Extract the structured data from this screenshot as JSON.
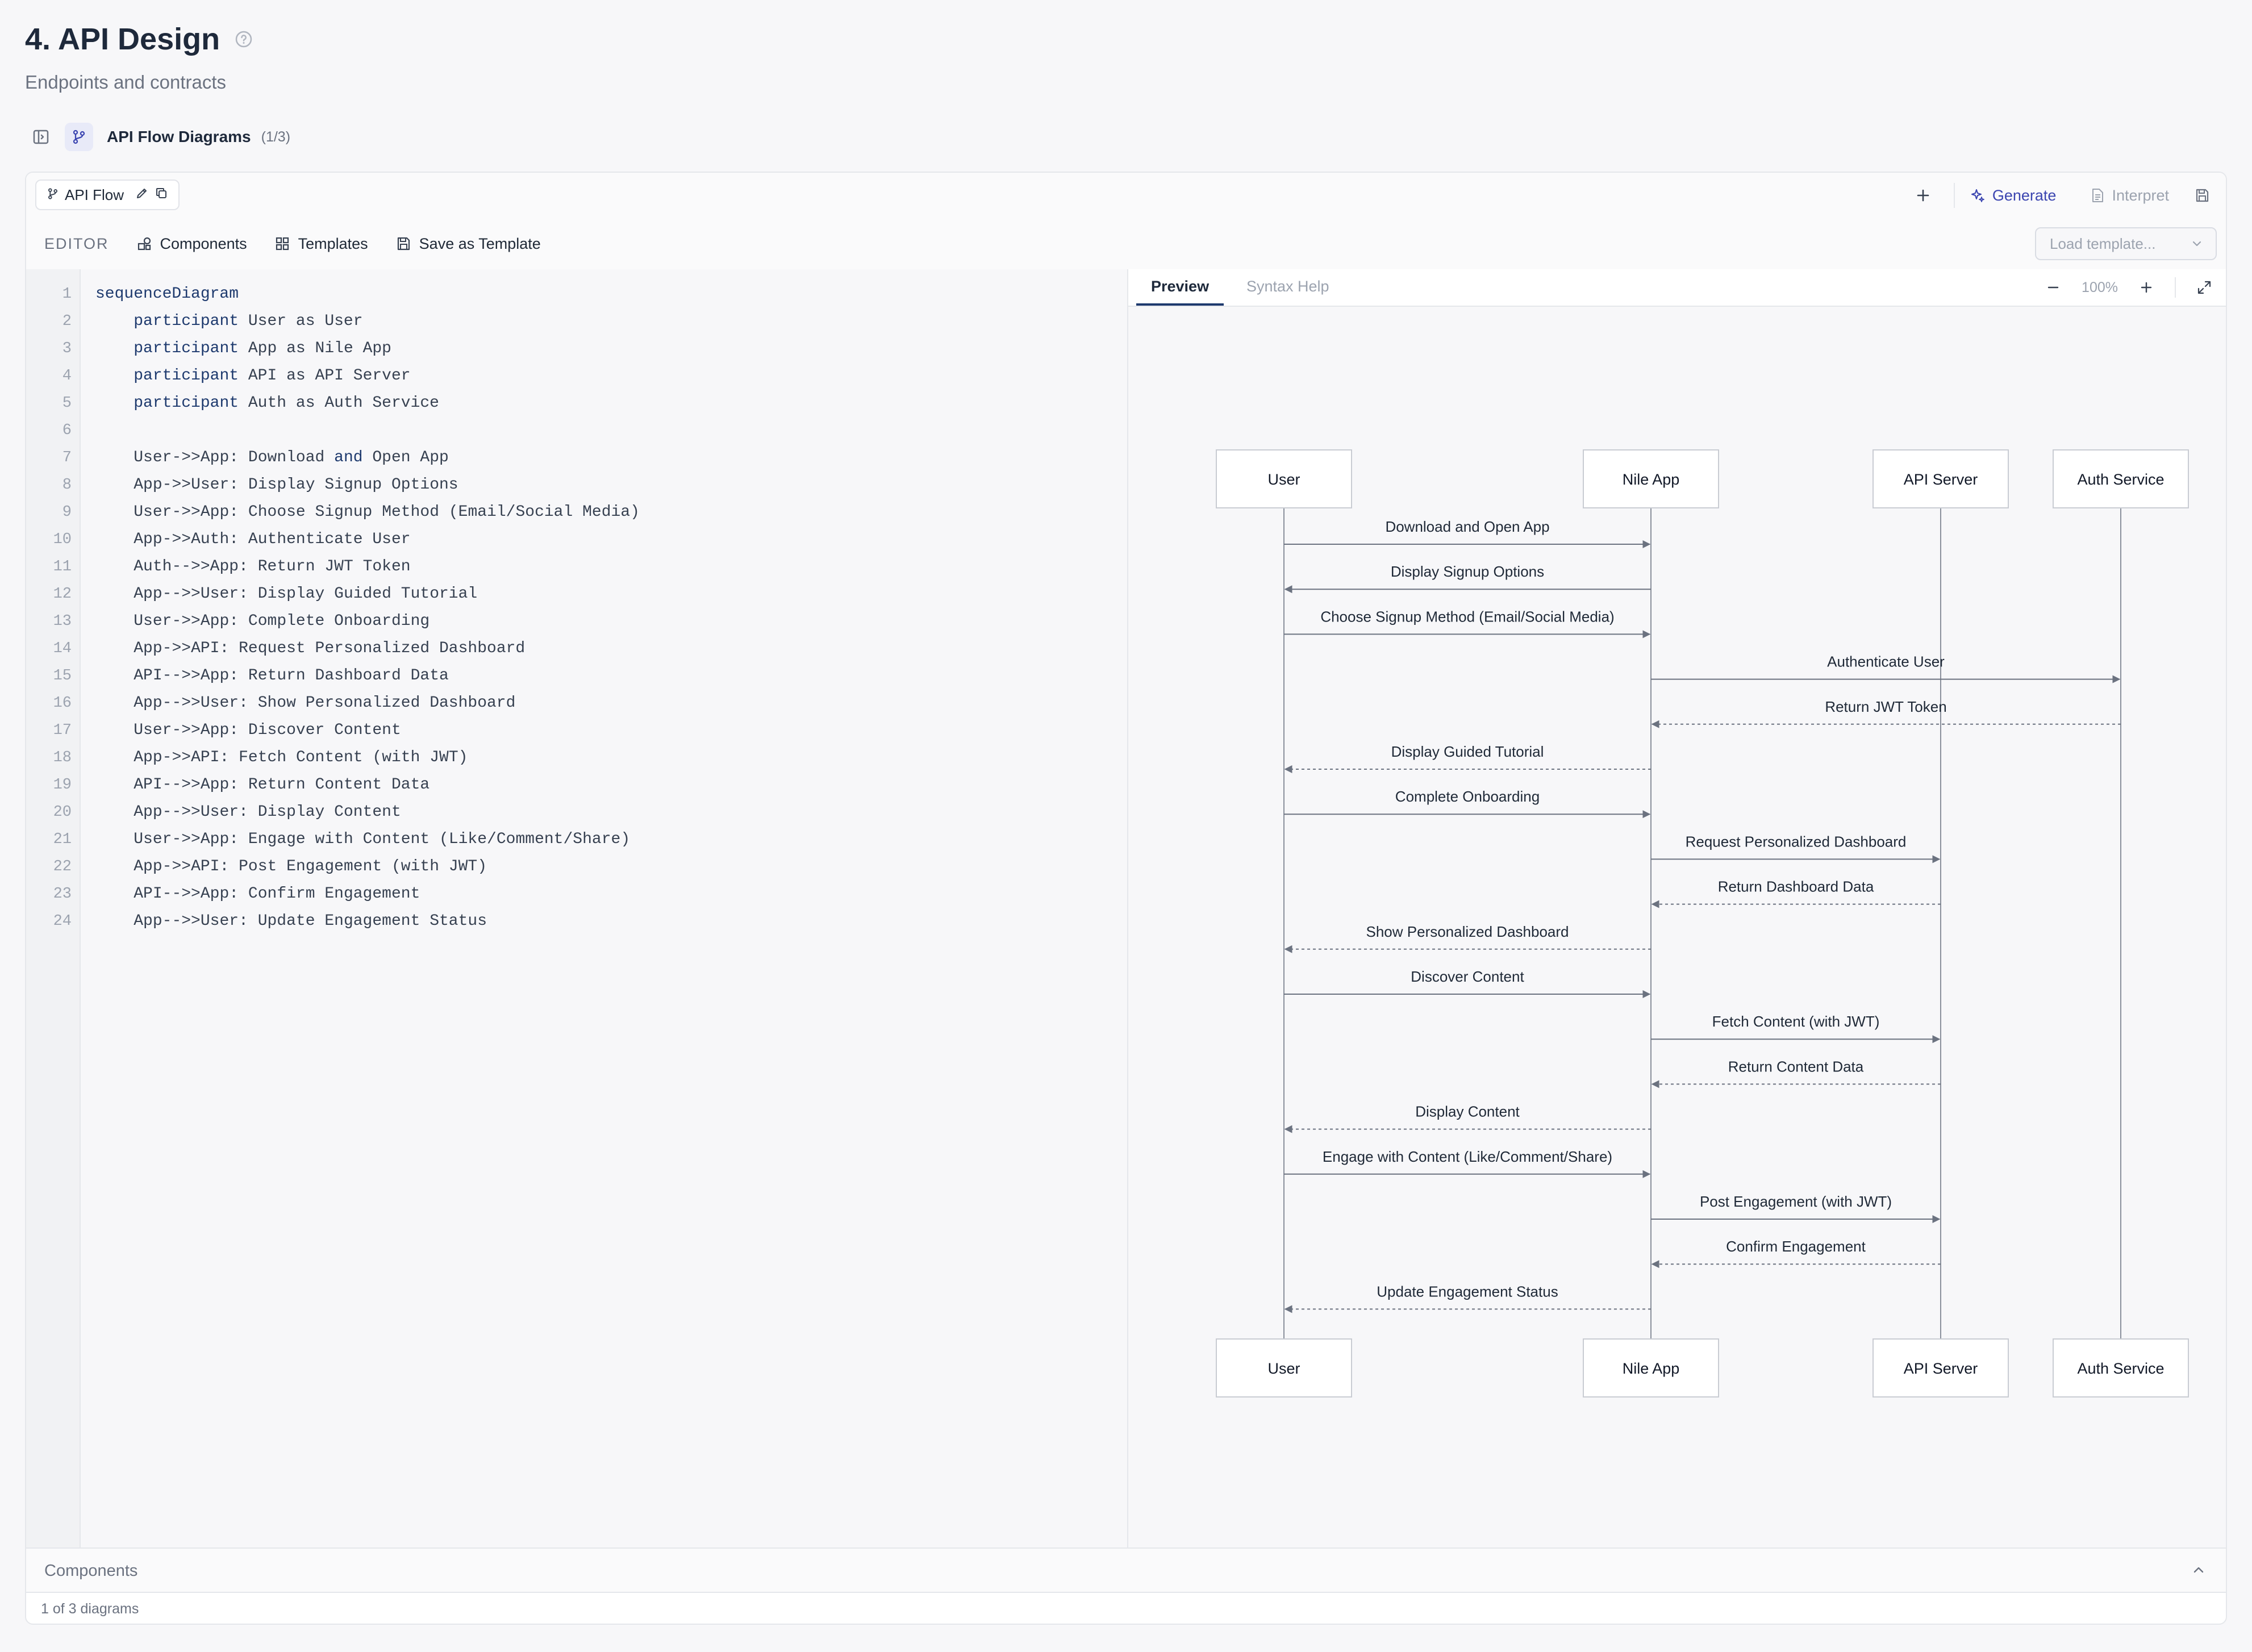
{
  "page": {
    "title": "4. API Design",
    "subtitle": "Endpoints and contracts"
  },
  "section": {
    "title": "API Flow Diagrams",
    "count": "(1/3)"
  },
  "diagram_tab": {
    "label": "API Flow"
  },
  "top_actions": {
    "generate": "Generate",
    "interpret": "Interpret"
  },
  "toolbar": {
    "editor_label": "EDITOR",
    "components": "Components",
    "templates": "Templates",
    "save_as_template": "Save as Template",
    "load_template_placeholder": "Load template..."
  },
  "preview_tabs": {
    "preview": "Preview",
    "syntax_help": "Syntax Help"
  },
  "zoom": {
    "level": "100%"
  },
  "code_lines": [
    "sequenceDiagram",
    "    participant User as User",
    "    participant App as Nile App",
    "    participant API as API Server",
    "    participant Auth as Auth Service",
    "",
    "    User->>App: Download and Open App",
    "    App->>User: Display Signup Options",
    "    User->>App: Choose Signup Method (Email/Social Media)",
    "    App->>Auth: Authenticate User",
    "    Auth-->>App: Return JWT Token",
    "    App-->>User: Display Guided Tutorial",
    "    User->>App: Complete Onboarding",
    "    App->>API: Request Personalized Dashboard",
    "    API-->>App: Return Dashboard Data",
    "    App-->>User: Show Personalized Dashboard",
    "    User->>App: Discover Content",
    "    App->>API: Fetch Content (with JWT)",
    "    API-->>App: Return Content Data",
    "    App-->>User: Display Content",
    "    User->>App: Engage with Content (Like/Comment/Share)",
    "    App->>API: Post Engagement (with JWT)",
    "    API-->>App: Confirm Engagement",
    "    App-->>User: Update Engagement Status"
  ],
  "code_keywords": [
    "sequenceDiagram",
    "participant",
    "and"
  ],
  "sequence": {
    "participants": [
      {
        "id": "User",
        "label": "User"
      },
      {
        "id": "App",
        "label": "Nile App"
      },
      {
        "id": "API",
        "label": "API Server"
      },
      {
        "id": "Auth",
        "label": "Auth Service"
      }
    ],
    "messages": [
      {
        "from": "User",
        "to": "App",
        "text": "Download and Open App",
        "dashed": false
      },
      {
        "from": "App",
        "to": "User",
        "text": "Display Signup Options",
        "dashed": false
      },
      {
        "from": "User",
        "to": "App",
        "text": "Choose Signup Method (Email/Social Media)",
        "dashed": false
      },
      {
        "from": "App",
        "to": "Auth",
        "text": "Authenticate User",
        "dashed": false
      },
      {
        "from": "Auth",
        "to": "App",
        "text": "Return JWT Token",
        "dashed": true
      },
      {
        "from": "App",
        "to": "User",
        "text": "Display Guided Tutorial",
        "dashed": true
      },
      {
        "from": "User",
        "to": "App",
        "text": "Complete Onboarding",
        "dashed": false
      },
      {
        "from": "App",
        "to": "API",
        "text": "Request Personalized Dashboard",
        "dashed": false
      },
      {
        "from": "API",
        "to": "App",
        "text": "Return Dashboard Data",
        "dashed": true
      },
      {
        "from": "App",
        "to": "User",
        "text": "Show Personalized Dashboard",
        "dashed": true
      },
      {
        "from": "User",
        "to": "App",
        "text": "Discover Content",
        "dashed": false
      },
      {
        "from": "App",
        "to": "API",
        "text": "Fetch Content (with JWT)",
        "dashed": false
      },
      {
        "from": "API",
        "to": "App",
        "text": "Return Content Data",
        "dashed": true
      },
      {
        "from": "App",
        "to": "User",
        "text": "Display Content",
        "dashed": true
      },
      {
        "from": "User",
        "to": "App",
        "text": "Engage with Content (Like/Comment/Share)",
        "dashed": false
      },
      {
        "from": "App",
        "to": "API",
        "text": "Post Engagement (with JWT)",
        "dashed": false
      },
      {
        "from": "API",
        "to": "App",
        "text": "Confirm Engagement",
        "dashed": true
      },
      {
        "from": "App",
        "to": "User",
        "text": "Update Engagement Status",
        "dashed": true
      }
    ]
  },
  "components_panel": {
    "title": "Components"
  },
  "footer": {
    "status": "1 of 3 diagrams"
  },
  "colors": {
    "accent": "#3b45b0",
    "keyword": "#1e3a6e",
    "line": "#6b7280",
    "text_primary": "#1e293b"
  },
  "icons": {
    "help": "help-circle-icon",
    "sidebar_toggle": "sidebar-toggle-icon",
    "branch": "git-branch-icon",
    "edit": "pencil-icon",
    "duplicate": "copy-icon",
    "add": "plus-icon",
    "generate": "sparkles-icon",
    "interpret": "file-text-icon",
    "save": "save-icon",
    "components": "shapes-icon",
    "templates": "grid-icon",
    "save_template": "floppy-icon",
    "dropdown": "chevron-down-icon",
    "zoom_out": "minus-icon",
    "zoom_in": "plus-icon",
    "fullscreen": "expand-icon",
    "collapse": "chevron-up-icon"
  }
}
